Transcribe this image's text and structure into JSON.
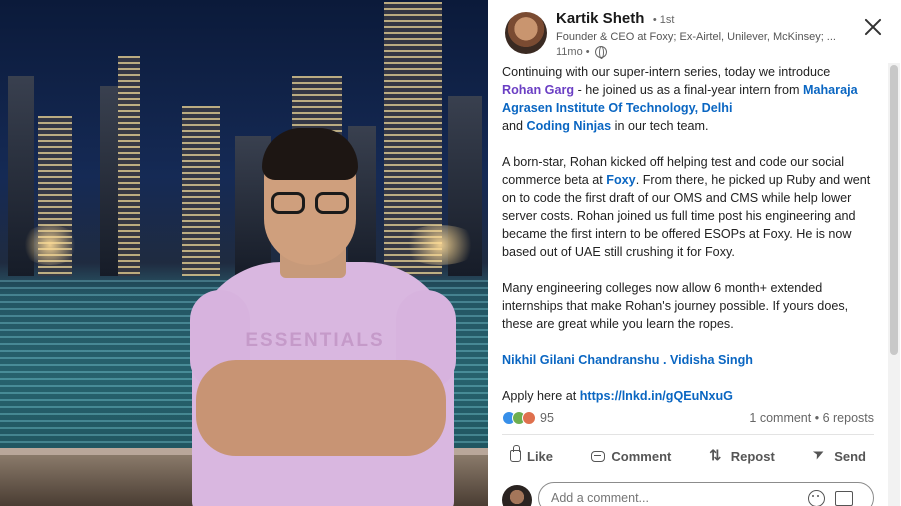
{
  "author": {
    "name": "Kartik Sheth",
    "degree": "• 1st",
    "headline": "Founder & CEO at Foxy; Ex-Airtel, Unilever, McKinsey; ...",
    "time": "11mo •"
  },
  "photo": {
    "shirt_text": "ESSENTIALS"
  },
  "post": {
    "p1_a": "Continuing with our super-intern series, today we introduce ",
    "p1_mention": "Rohan Garg",
    "p1_b": " - he joined us as a final-year intern from ",
    "p1_link1": "Maharaja Agrasen Institute Of Technology, Delhi",
    "p1_c": " and ",
    "p1_link2": "Coding Ninjas",
    "p1_d": " in our tech team.",
    "p2_a": "A born-star, Rohan kicked off helping test and code our social commerce beta at ",
    "p2_link": "Foxy",
    "p2_b": ". From there, he picked up Ruby and went on to code the first draft of our OMS and CMS while help lower server costs. Rohan joined us full time post his engineering and became the first intern to be offered ESOPs at Foxy. He is now based out of UAE still crushing it for Foxy.",
    "p3": "Many engineering colleges now allow 6 month+ extended internships that make Rohan's journey possible. If yours does, these are great while you learn the ropes.",
    "p4_mention1": "Nikhil Gilani Chandranshu",
    "p4_sep": " . ",
    "p4_mention2": "Vidisha Singh",
    "p5_a": "Apply here at ",
    "p5_link": "https://lnkd.in/gQEuNxuG"
  },
  "social": {
    "reaction_count": "95",
    "comments": "1 comment",
    "sep": " • ",
    "reposts": "6 reposts",
    "reaction_icons": [
      "like-icon",
      "celebrate-icon",
      "love-icon"
    ]
  },
  "actions": {
    "like": "Like",
    "comment": "Comment",
    "repost": "Repost",
    "send": "Send"
  },
  "comment_box": {
    "placeholder": "Add a comment..."
  },
  "colors": {
    "link": "#0a66c2",
    "mention": "#6b3fc4"
  }
}
